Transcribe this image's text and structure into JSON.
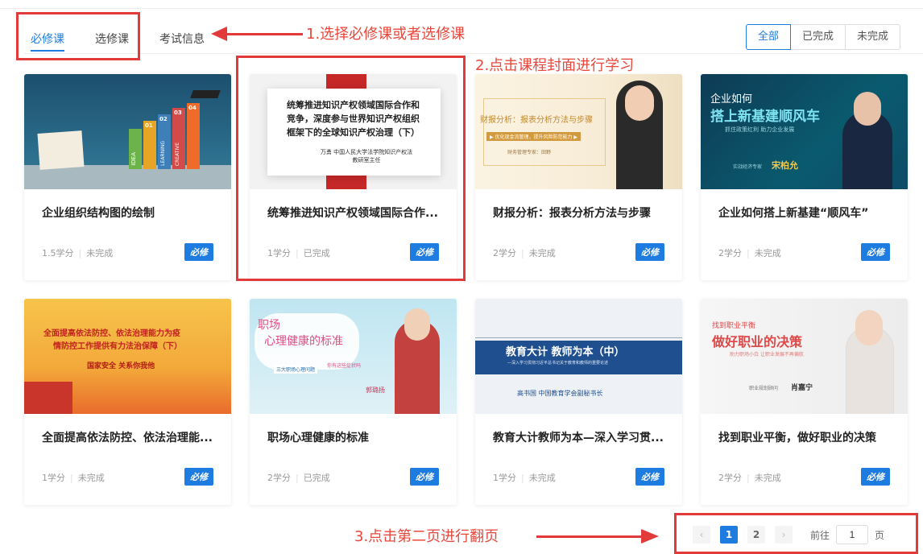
{
  "tabs": [
    "必修课",
    "选修课",
    "考试信息"
  ],
  "filters": [
    "全部",
    "已完成",
    "未完成"
  ],
  "annotations": {
    "step1": "1.选择必修课或者选修课",
    "step2": "2.点击课程封面进行学习",
    "step3": "3.点击第二页进行翻页"
  },
  "courses": [
    {
      "title": "企业组织结构图的绘制",
      "credit": "1.5学分",
      "status": "未完成",
      "badge": "必修"
    },
    {
      "title": "统筹推进知识产权领域国际合作...",
      "credit": "1学分",
      "status": "已完成",
      "badge": "必修"
    },
    {
      "title": "财报分析：报表分析方法与步骤",
      "credit": "2学分",
      "status": "未完成",
      "badge": "必修"
    },
    {
      "title": "企业如何搭上新基建“顺风车”",
      "credit": "2学分",
      "status": "未完成",
      "badge": "必修"
    },
    {
      "title": "全面提高依法防控、依法治理能...",
      "credit": "1学分",
      "status": "未完成",
      "badge": "必修"
    },
    {
      "title": "职场心理健康的标准",
      "credit": "2学分",
      "status": "已完成",
      "badge": "必修"
    },
    {
      "title": "教育大计教师为本—深入学习贯...",
      "credit": "1学分",
      "status": "未完成",
      "badge": "必修"
    },
    {
      "title": "找到职业平衡，做好职业的决策",
      "credit": "2学分",
      "status": "未完成",
      "badge": "必修"
    }
  ],
  "covers": {
    "c1": {
      "l1": "01",
      "l2": "02",
      "l3": "03",
      "l4": "04",
      "b1": "IDEA",
      "b2": "CREATIVE",
      "b3": "LEARNING"
    },
    "c2": {
      "line1": "统筹推进知识产权领域国际合作和",
      "line2": "竞争，深度参与世界知识产权组织",
      "line3": "框架下的全球知识产权治理（下）",
      "author": "万勇  中国人民大学法学院知识产权法",
      "role": "教研室主任"
    },
    "c3": {
      "title": "财报分析：报表分析方法与步骤",
      "sub": "▶ 优化现金流管理，提升风险防范能力 ▶",
      "expert": "财务管理专家：田野"
    },
    "c4": {
      "l1": "企业如何",
      "l2": "搭上新基建顺风车",
      "sub": "抓住政策红利  助力企业发展",
      "name": "宋柏允",
      "role": "实战经济专家"
    },
    "c5": {
      "l1": "全面提高依法防控、依法治理能力为疫",
      "l2": "情防控工作提供有力法治保障（下）",
      "l3": "国家安全 关系你我他"
    },
    "c6": {
      "l1": "职场",
      "l2": "心理健康的标准",
      "tag1": "三大职场心理问题",
      "tag2": "你有这些症状吗",
      "name": "郭璐扬"
    },
    "c7": {
      "l1": "教育大计   教师为本（中）",
      "l2": "—深入学习贯彻习近平总书记关于教育和教师的重要论述",
      "l3": "高书国   中国教育学会副秘书长"
    },
    "c8": {
      "l1": "找到职业平衡",
      "l2": "做好职业的决策",
      "sub": "助力职场小白  让职业发展不再偏航",
      "name": "肖嘉宁",
      "role": "职业规划顾问"
    }
  },
  "pager": {
    "prev": "‹",
    "p1": "1",
    "p2": "2",
    "next": "›",
    "goto": "前往",
    "value": "1",
    "unit": "页"
  }
}
